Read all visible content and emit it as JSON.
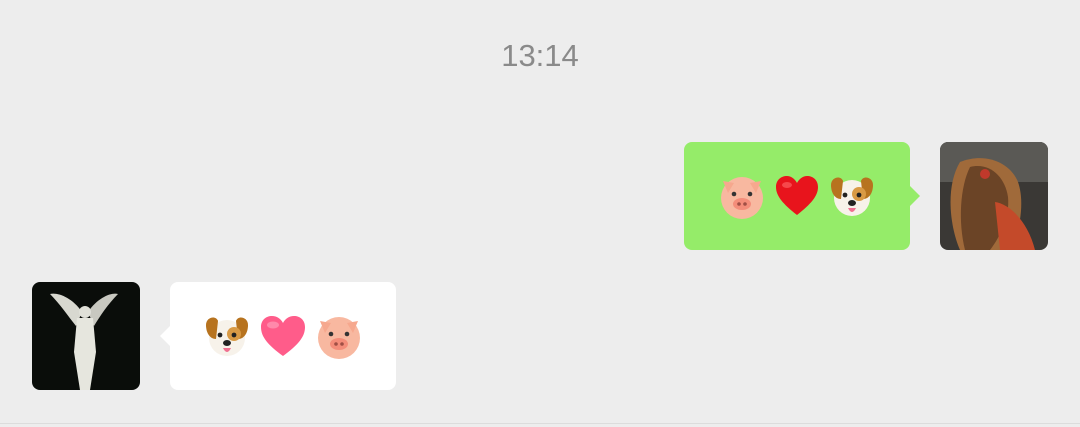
{
  "chat": {
    "timestamp": "13:14",
    "messages": [
      {
        "direction": "sent",
        "emojis": [
          "pig-face",
          "red-heart",
          "dog-face"
        ],
        "bubble_color": "#95ec69"
      },
      {
        "direction": "received",
        "emojis": [
          "dog-face",
          "pink-heart",
          "pig-face"
        ],
        "bubble_color": "#ffffff"
      }
    ]
  },
  "colors": {
    "background": "#ededed",
    "timestamp_text": "#8a8a8a",
    "sent_bubble": "#95ec69",
    "received_bubble": "#ffffff"
  }
}
